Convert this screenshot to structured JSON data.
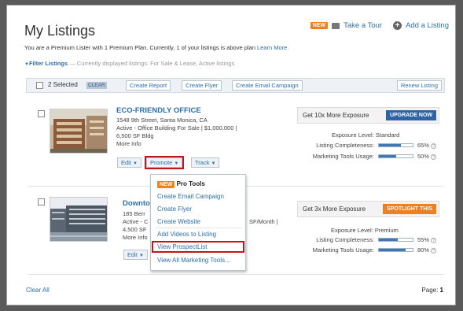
{
  "header": {
    "title": "My Listings",
    "new_badge": "NEW",
    "take_tour": "Take a Tour",
    "add_listing": "Add a Listing"
  },
  "intro": {
    "text": "You are a Premium Lister with 1 Premium Plan. Currently, 1 of your listings is above plan ",
    "learn_more": "Learn More."
  },
  "filters": {
    "label": "Filter Listings",
    "text": " — Currently displayed listings: For Sale & Lease, Active listings"
  },
  "toolbar": {
    "selected": "2 Selected",
    "clear": "CLEAR",
    "create_report": "Create Report",
    "create_flyer": "Create Flyer",
    "create_email": "Create Email Campaign",
    "renew": "Renew Listing"
  },
  "listings": [
    {
      "title": "ECO-FRIENDLY OFFICE",
      "address": "1548 9th Street, Santa Monica, CA",
      "line2": "Active - Office Building For Sale | $1,000,000 |",
      "line3": "6,500 SF Bldg",
      "more": "More Info",
      "edit": "Edit",
      "promote": "Promote",
      "track": "Track",
      "exposure_cta": "Get 10x More Exposure",
      "upgrade": "UPGRADE NOW",
      "exposure_level": "Exposure Level: Standard",
      "completeness_label": "Listing Completeness:",
      "completeness_pct": "65%",
      "completeness_value": 0.65,
      "tools_label": "Marketing Tools Usage:",
      "tools_pct": "50%",
      "tools_value": 0.5
    },
    {
      "title": "Downto",
      "address": "185 Berr",
      "line2": "Active - C",
      "line2_tail": "SF/Month |",
      "line3": "4,500 SF",
      "more": "More Info",
      "edit": "Edit",
      "exposure_cta": "Get 3x More Exposure",
      "upgrade": "SPOTLIGHT THIS",
      "exposure_level": "Exposure Level: Premium",
      "completeness_label": "Listing Completeness:",
      "completeness_pct": "55%",
      "completeness_value": 0.55,
      "tools_label": "Marketing Tools Usage:",
      "tools_pct": "80%",
      "tools_value": 0.8
    }
  ],
  "promote_menu": {
    "badge": "NEW",
    "pro_tools": "Pro Tools",
    "items": [
      "Create Email Campaign",
      "Create Flyer",
      "Create Website",
      "Add Videos to Listing",
      "View ProspectList",
      "View All Marketing Tools..."
    ]
  },
  "footer": {
    "clear_all": "Clear All",
    "page_label": "Page:",
    "page_num": "1"
  },
  "colors": {
    "link": "#2d6fa8",
    "accent_orange": "#f07f1e",
    "upgrade_blue": "#2f63a8",
    "highlight_red": "#c01818"
  }
}
